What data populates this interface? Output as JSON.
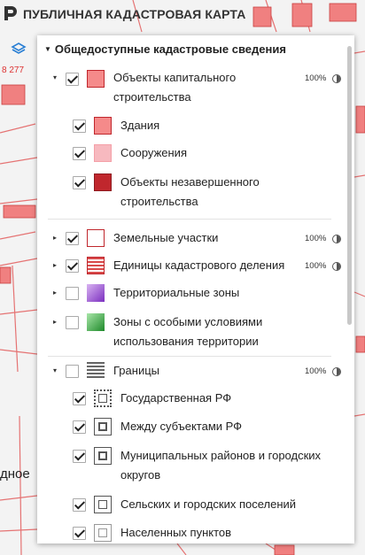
{
  "app": {
    "title": "ПУБЛИЧНАЯ КАДАСТРОВАЯ КАРТА"
  },
  "map": {
    "parcel_label": "8 277",
    "place_text": "дное",
    "parcel_color": "#f08080",
    "line_color": "#e57373"
  },
  "panel": {
    "header": "Общедоступные кадастровые сведения",
    "layers": [
      {
        "label": "Объекты капитального строительства",
        "checked": true,
        "opacity": "100%",
        "expander": "▾",
        "swatch": "#f58a8a"
      },
      {
        "label": "Здания",
        "checked": true,
        "swatch": "#f58a8a"
      },
      {
        "label": "Сооружения",
        "checked": true,
        "swatch": "#f7b9bf"
      },
      {
        "label": "Объекты незавершенного строительства",
        "checked": true,
        "swatch": "#c0272d"
      },
      {
        "label": "Земельные участки",
        "checked": true,
        "opacity": "100%",
        "expander": "▸",
        "swatch": "#ffffff"
      },
      {
        "label": "Единицы кадастрового деления",
        "checked": true,
        "opacity": "100%",
        "expander": "▸",
        "swatch": "#d94b4b"
      },
      {
        "label": "Территориальные зоны",
        "checked": false,
        "expander": "▸",
        "swatch": "#a15fd6"
      },
      {
        "label": "Зоны с особыми условиями использования территории",
        "checked": false,
        "expander": "▸",
        "swatch": "#3db04a"
      },
      {
        "label": "Границы",
        "checked": false,
        "opacity": "100%",
        "expander": "▾",
        "swatch": "#666666"
      },
      {
        "label": "Государственная РФ",
        "checked": true,
        "swatch": "#555555"
      },
      {
        "label": "Между субъектами РФ",
        "checked": true,
        "swatch": "#555555"
      },
      {
        "label": "Муниципальных районов и городских округов",
        "checked": true,
        "swatch": "#555555"
      },
      {
        "label": "Сельских и городских поселений",
        "checked": true,
        "swatch": "#555555"
      },
      {
        "label": "Населенных пунктов",
        "checked": true,
        "swatch": "#555555"
      }
    ]
  }
}
